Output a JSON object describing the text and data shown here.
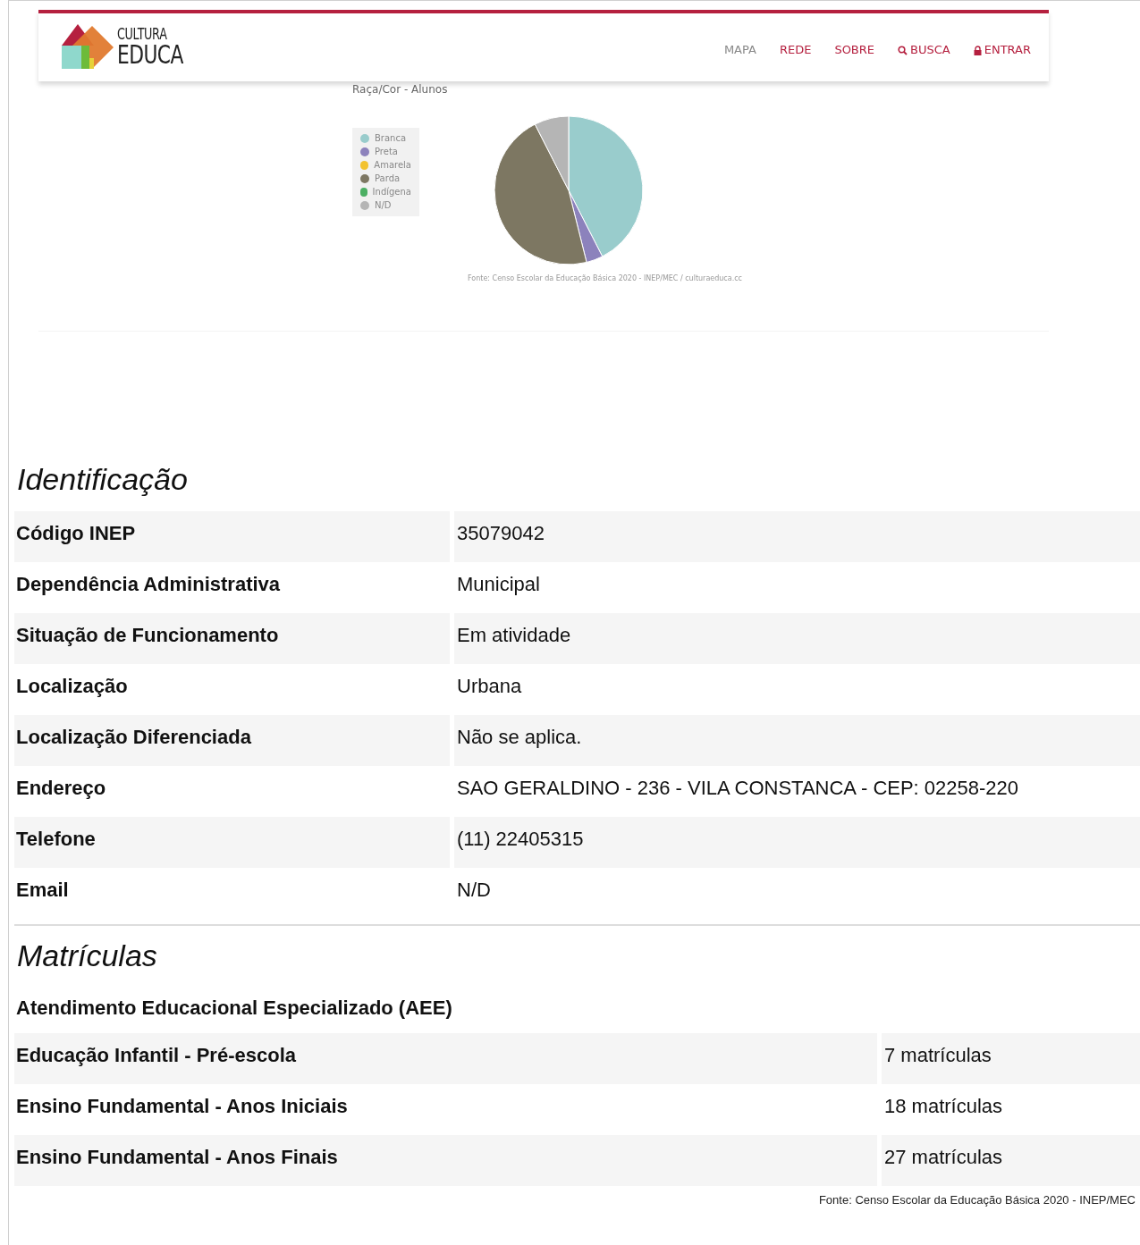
{
  "header": {
    "logo_top": "CULTURA",
    "logo_bottom": "EDUCA",
    "nav": [
      {
        "label": "MAPA",
        "kind": "plain",
        "selected": true
      },
      {
        "label": "REDE",
        "kind": "plain",
        "selected": false
      },
      {
        "label": "SOBRE",
        "kind": "plain",
        "selected": false
      },
      {
        "label": "BUSCA",
        "kind": "search",
        "selected": false
      },
      {
        "label": "ENTRAR",
        "kind": "login",
        "selected": false
      }
    ]
  },
  "chart": {
    "title": "Raça/Cor - Alunos",
    "legend": [
      {
        "label": "Branca",
        "color": "#99cccc"
      },
      {
        "label": "Preta",
        "color": "#8c82bc"
      },
      {
        "label": "Amarela",
        "color": "#f2c230"
      },
      {
        "label": "Parda",
        "color": "#7d7762"
      },
      {
        "label": "Indígena",
        "color": "#4caf63"
      },
      {
        "label": "N/D",
        "color": "#b5b5b5"
      }
    ],
    "source": "Fonte: Censo Escolar da Educação Básica 2020 - INEP/MEC / culturaeduca.cc"
  },
  "identificacao": {
    "heading": "Identificação",
    "rows": [
      {
        "label": "Código INEP",
        "value": "35079042"
      },
      {
        "label": "Dependência Administrativa",
        "value": "Municipal"
      },
      {
        "label": "Situação de Funcionamento",
        "value": "Em atividade"
      },
      {
        "label": "Localização",
        "value": "Urbana"
      },
      {
        "label": "Localização Diferenciada",
        "value": "Não se aplica."
      },
      {
        "label": "Endereço",
        "value": "SAO GERALDINO - 236 - VILA CONSTANCA - CEP: 02258-220"
      },
      {
        "label": "Telefone",
        "value": "(11) 22405315"
      },
      {
        "label": "Email",
        "value": "N/D"
      }
    ]
  },
  "matriculas": {
    "heading": "Matrículas",
    "subheading": "Atendimento Educacional Especializado (AEE)",
    "rows": [
      {
        "label": "Educação Infantil - Pré-escola",
        "value": "7 matrículas"
      },
      {
        "label": "Ensino Fundamental - Anos Iniciais",
        "value": "18 matrículas"
      },
      {
        "label": "Ensino Fundamental - Anos Finais",
        "value": "27 matrículas"
      }
    ],
    "source": "Fonte: Censo Escolar da Educação Básica 2020 - INEP/MEC"
  }
}
